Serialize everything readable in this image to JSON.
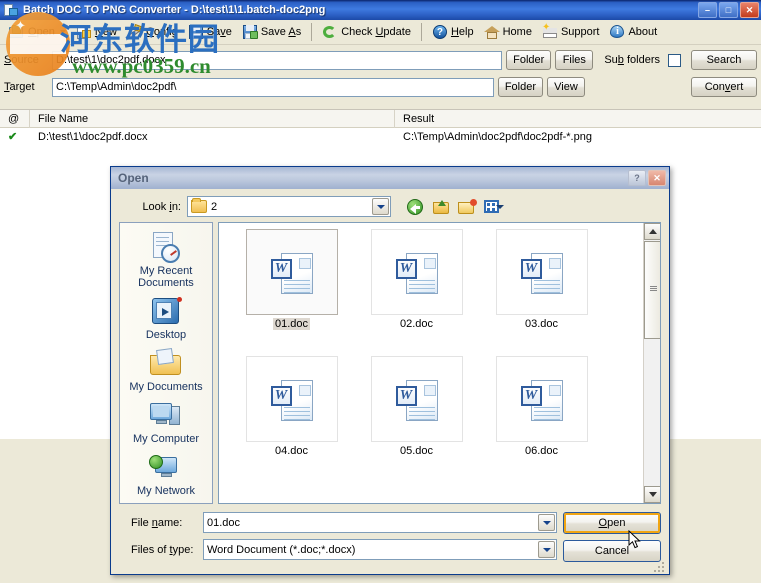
{
  "window": {
    "title": "Batch DOC TO PNG Converter - D:\\test\\1\\1.batch-doc2png",
    "icon": "app-icon",
    "minimize": "–",
    "maximize": "□",
    "close": "✕"
  },
  "toolbar": {
    "items": [
      {
        "label": "Open",
        "accel": "O",
        "icon": "open-folder-icon",
        "dropdown": true
      },
      {
        "label": "New",
        "accel": "N",
        "icon": "new-document-icon",
        "dropdown": false
      },
      {
        "label": "Config",
        "accel": "C",
        "icon": "config-tools-icon",
        "dropdown": false
      },
      {
        "label": "Save",
        "accel": "v",
        "icon": "save-disk-icon",
        "dropdown": false
      },
      {
        "label": "Save As",
        "accel": "A",
        "icon": "save-as-disk-icon",
        "dropdown": false
      },
      {
        "label": "Check Update",
        "accel": "U",
        "icon": "refresh-icon",
        "dropdown": false
      },
      {
        "label": "Help",
        "accel": "H",
        "icon": "help-question-icon",
        "dropdown": false
      },
      {
        "label": "Home",
        "accel": "",
        "icon": "home-house-icon",
        "dropdown": false
      },
      {
        "label": "Support",
        "accel": "",
        "icon": "support-envelope-icon",
        "dropdown": false
      },
      {
        "label": "About",
        "accel": "",
        "icon": "about-info-icon",
        "dropdown": false
      }
    ]
  },
  "paths": {
    "source_label": "Source",
    "source_accel": "S",
    "source_value": "D:\\test\\1\\doc2pdf.docx",
    "target_label": "Target",
    "target_accel": "T",
    "target_value": "C:\\Temp\\Admin\\doc2pdf\\",
    "folder_button": "Folder",
    "files_button": "Files",
    "view_button": "View",
    "sub_folders_label": "Sub folders",
    "sub_folders_accel": "b",
    "sub_folders_checked": false,
    "search_button": "Search",
    "convert_button": "Convert",
    "convert_accel": "v"
  },
  "list": {
    "columns": [
      "@",
      "File Name",
      "Result"
    ],
    "rows": [
      {
        "status": "✔",
        "file_name": "D:\\test\\1\\doc2pdf.docx",
        "result": "C:\\Temp\\Admin\\doc2pdf\\doc2pdf-*.png"
      }
    ]
  },
  "watermark": {
    "cn_text": "河东软件园",
    "url_text": "www.pc0359.cn",
    "cn_color": "#2b6fc0",
    "url_color": "#2e8b2e"
  },
  "dialog": {
    "title": "Open",
    "help_button": "?",
    "close_button": "✕",
    "lookin_label": "Look in:",
    "lookin_accel": "i",
    "lookin_value": "2",
    "tools": [
      {
        "name": "back-arrow-icon"
      },
      {
        "name": "up-one-level-icon"
      },
      {
        "name": "create-new-folder-icon"
      },
      {
        "name": "views-dropdown-icon"
      }
    ],
    "places": [
      {
        "label": "My Recent Documents",
        "icon": "recent-documents-icon"
      },
      {
        "label": "Desktop",
        "icon": "desktop-icon"
      },
      {
        "label": "My Documents",
        "icon": "my-documents-icon"
      },
      {
        "label": "My Computer",
        "icon": "my-computer-icon"
      },
      {
        "label": "My Network",
        "icon": "my-network-places-icon"
      }
    ],
    "files": [
      {
        "name": "01.doc",
        "icon": "word-document-icon",
        "selected": true
      },
      {
        "name": "02.doc",
        "icon": "word-document-icon",
        "selected": false
      },
      {
        "name": "03.doc",
        "icon": "word-document-icon",
        "selected": false
      },
      {
        "name": "04.doc",
        "icon": "word-document-icon",
        "selected": false
      },
      {
        "name": "05.doc",
        "icon": "word-document-icon",
        "selected": false
      },
      {
        "name": "06.doc",
        "icon": "word-document-icon",
        "selected": false
      }
    ],
    "filename_label": "File name:",
    "filename_accel": "n",
    "filename_value": "01.doc",
    "filetype_label": "Files of type:",
    "filetype_accel": "t",
    "filetype_value": "Word Document (*.doc;*.docx)",
    "open_button": "Open",
    "open_accel": "O",
    "cancel_button": "Cancel",
    "word_glyph": "W"
  }
}
